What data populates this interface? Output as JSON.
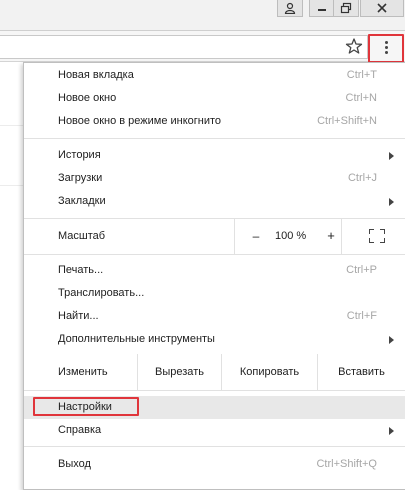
{
  "accent_colors": {
    "highlight": "#e0353b",
    "shortcut": "#a6a6a6"
  },
  "window_controls": [
    "user-icon",
    "minimize-icon",
    "restore-icon",
    "close-icon"
  ],
  "toolbar": {
    "bookmark_icon": "star-icon",
    "menu_icon": "three-dots-vertical-icon"
  },
  "menu": {
    "new_tab": {
      "label": "Новая вкладка",
      "shortcut": "Ctrl+T"
    },
    "new_window": {
      "label": "Новое окно",
      "shortcut": "Ctrl+N"
    },
    "incognito": {
      "label": "Новое окно в режиме инкогнито",
      "shortcut": "Ctrl+Shift+N"
    },
    "history": {
      "label": "История"
    },
    "downloads": {
      "label": "Загрузки",
      "shortcut": "Ctrl+J"
    },
    "bookmarks": {
      "label": "Закладки"
    },
    "zoom": {
      "label": "Масштаб",
      "minus": "–",
      "value": "100 %",
      "plus": "+"
    },
    "print": {
      "label": "Печать...",
      "shortcut": "Ctrl+P"
    },
    "cast": {
      "label": "Транслировать..."
    },
    "find": {
      "label": "Найти...",
      "shortcut": "Ctrl+F"
    },
    "more_tools": {
      "label": "Дополнительные инструменты"
    },
    "edit": {
      "label": "Изменить",
      "cut": "Вырезать",
      "copy": "Копировать",
      "paste": "Вставить"
    },
    "settings": {
      "label": "Настройки"
    },
    "help": {
      "label": "Справка"
    },
    "exit": {
      "label": "Выход",
      "shortcut": "Ctrl+Shift+Q"
    }
  }
}
